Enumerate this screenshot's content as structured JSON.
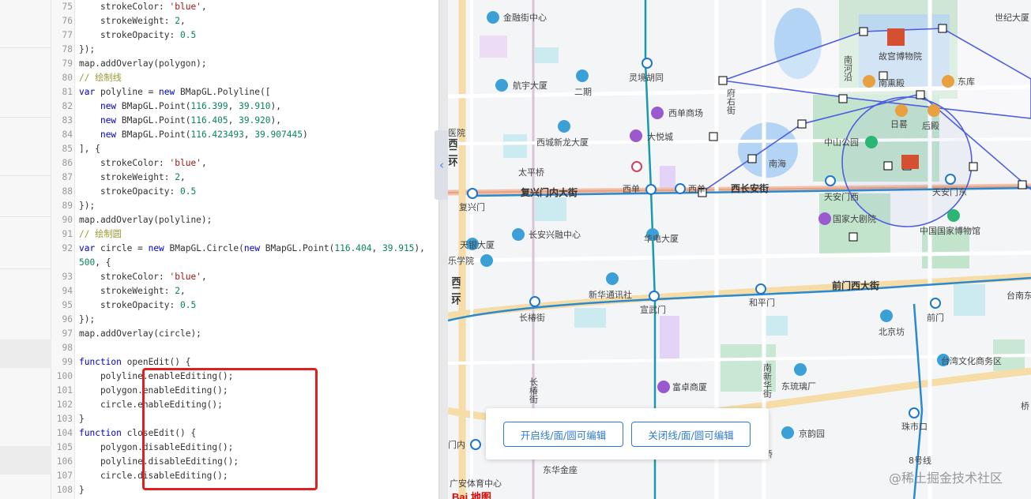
{
  "editor": {
    "lines": [
      {
        "n": "75",
        "segs": [
          [
            "",
            "    strokeColor: "
          ],
          [
            "str",
            "'blue'"
          ],
          [
            "",
            ","
          ]
        ]
      },
      {
        "n": "76",
        "segs": [
          [
            "",
            "    strokeWeight: "
          ],
          [
            "num",
            "2"
          ],
          [
            "",
            ","
          ]
        ]
      },
      {
        "n": "77",
        "segs": [
          [
            "",
            "    strokeOpacity: "
          ],
          [
            "num",
            "0.5"
          ]
        ]
      },
      {
        "n": "78",
        "segs": [
          [
            "",
            "});"
          ]
        ]
      },
      {
        "n": "79",
        "segs": [
          [
            "",
            "map.addOverlay(polygon);"
          ]
        ]
      },
      {
        "n": "80",
        "segs": [
          [
            "cm",
            "// 绘制线"
          ]
        ]
      },
      {
        "n": "81",
        "segs": [
          [
            "kw",
            "var"
          ],
          [
            "",
            " polyline = "
          ],
          [
            "kw",
            "new"
          ],
          [
            "",
            " BMapGL.Polyline(["
          ]
        ]
      },
      {
        "n": "82",
        "segs": [
          [
            "",
            "    "
          ],
          [
            "kw",
            "new"
          ],
          [
            "",
            " BMapGL.Point("
          ],
          [
            "num",
            "116.399"
          ],
          [
            "",
            ", "
          ],
          [
            "num",
            "39.910"
          ],
          [
            "",
            "),"
          ]
        ]
      },
      {
        "n": "83",
        "segs": [
          [
            "",
            "    "
          ],
          [
            "kw",
            "new"
          ],
          [
            "",
            " BMapGL.Point("
          ],
          [
            "num",
            "116.405"
          ],
          [
            "",
            ", "
          ],
          [
            "num",
            "39.920"
          ],
          [
            "",
            "),"
          ]
        ]
      },
      {
        "n": "84",
        "segs": [
          [
            "",
            "    "
          ],
          [
            "kw",
            "new"
          ],
          [
            "",
            " BMapGL.Point("
          ],
          [
            "num",
            "116.423493"
          ],
          [
            "",
            ", "
          ],
          [
            "num",
            "39.907445"
          ],
          [
            "",
            ")"
          ]
        ]
      },
      {
        "n": "85",
        "segs": [
          [
            "",
            "], {"
          ]
        ]
      },
      {
        "n": "86",
        "segs": [
          [
            "",
            "    strokeColor: "
          ],
          [
            "str",
            "'blue'"
          ],
          [
            "",
            ","
          ]
        ]
      },
      {
        "n": "87",
        "segs": [
          [
            "",
            "    strokeWeight: "
          ],
          [
            "num",
            "2"
          ],
          [
            "",
            ","
          ]
        ]
      },
      {
        "n": "88",
        "segs": [
          [
            "",
            "    strokeOpacity: "
          ],
          [
            "num",
            "0.5"
          ]
        ]
      },
      {
        "n": "89",
        "segs": [
          [
            "",
            "});"
          ]
        ]
      },
      {
        "n": "90",
        "segs": [
          [
            "",
            "map.addOverlay(polyline);"
          ]
        ]
      },
      {
        "n": "91",
        "segs": [
          [
            "cm",
            "// 绘制圆"
          ]
        ]
      },
      {
        "n": "92",
        "segs": [
          [
            "kw",
            "var"
          ],
          [
            "",
            " circle = "
          ],
          [
            "kw",
            "new"
          ],
          [
            "",
            " BMapGL.Circle("
          ],
          [
            "kw",
            "new"
          ],
          [
            "",
            " BMapGL.Point("
          ],
          [
            "num",
            "116.404"
          ],
          [
            "",
            ", "
          ],
          [
            "num",
            "39.915"
          ],
          [
            "",
            "),"
          ]
        ]
      },
      {
        "n": "",
        "segs": [
          [
            "num",
            "500"
          ],
          [
            "",
            ", {"
          ]
        ]
      },
      {
        "n": "93",
        "segs": [
          [
            "",
            "    strokeColor: "
          ],
          [
            "str",
            "'blue'"
          ],
          [
            "",
            ","
          ]
        ]
      },
      {
        "n": "94",
        "segs": [
          [
            "",
            "    strokeWeight: "
          ],
          [
            "num",
            "2"
          ],
          [
            "",
            ","
          ]
        ]
      },
      {
        "n": "95",
        "segs": [
          [
            "",
            "    strokeOpacity: "
          ],
          [
            "num",
            "0.5"
          ]
        ]
      },
      {
        "n": "96",
        "segs": [
          [
            "",
            "});"
          ]
        ]
      },
      {
        "n": "97",
        "segs": [
          [
            "",
            "map.addOverlay(circle);"
          ]
        ]
      },
      {
        "n": "98",
        "segs": []
      },
      {
        "n": "99",
        "segs": [
          [
            "kw",
            "function"
          ],
          [
            "",
            " openEdit() {"
          ]
        ]
      },
      {
        "n": "100",
        "segs": [
          [
            "",
            "    polyline.enableEditing();"
          ]
        ]
      },
      {
        "n": "101",
        "segs": [
          [
            "",
            "    polygon.enableEditing();"
          ]
        ]
      },
      {
        "n": "102",
        "segs": [
          [
            "",
            "    circle.enableEditing();"
          ]
        ]
      },
      {
        "n": "103",
        "segs": [
          [
            "",
            "}"
          ]
        ]
      },
      {
        "n": "104",
        "segs": [
          [
            "kw",
            "function"
          ],
          [
            "",
            " closeEdit() {"
          ]
        ]
      },
      {
        "n": "105",
        "segs": [
          [
            "",
            "    polygon.disableEditing();"
          ]
        ]
      },
      {
        "n": "106",
        "segs": [
          [
            "",
            "    polyline.disableEditing();"
          ]
        ]
      },
      {
        "n": "107",
        "segs": [
          [
            "",
            "    circle.disableEditing();"
          ]
        ]
      },
      {
        "n": "108",
        "segs": [
          [
            "",
            "}"
          ]
        ]
      }
    ]
  },
  "collapse_icon": "chevron-left-icon",
  "map": {
    "roads": {
      "fuxingmen": "复兴门内大街",
      "xichangan": "西长安街",
      "qianmen_west": "前门西大街",
      "west_2nd_ring": "西二环",
      "west_2nd_ring_2": "西二环",
      "fuyoujie": "府右街",
      "nanheyan": "南河沿",
      "changchunjie": "长椿街",
      "nanxinhuajie": "南新华街"
    },
    "pois": [
      "金融街中心",
      "灵境胡同",
      "航宇大厦",
      "二期",
      "西单商场",
      "西城新龙大厦",
      "大悦城",
      "太平桥",
      "西单",
      "西单",
      "复兴门",
      "长安兴融中心",
      "华电大厦",
      "天银大厦",
      "乐学院",
      "新华通讯社",
      "宣武门",
      "和平门",
      "长椿街",
      "前门",
      "北京坊",
      "台湾文化商务区",
      "东琉璃厂",
      "富卓商厦",
      "京韵园",
      "珠市口",
      "东华金座",
      "门内",
      "广安体育中心",
      "故宫博物院",
      "南熏殿",
      "东库",
      "日晷",
      "后殿",
      "中山公园",
      "南海",
      "天安门西",
      "天安门东",
      "国家大剧院",
      "中国国家博物馆",
      "世纪大厦",
      "医院",
      "台南东",
      "桥",
      "8号线",
      "桥"
    ],
    "colors": {
      "overlay_stroke": "#4d5fe0",
      "road_red": "#e3a090",
      "metro_blue": "#2a8ad0",
      "metro_teal": "#1a9aa8",
      "park_green": "#b5e1c5",
      "water_blue": "#b3d4f5"
    }
  },
  "buttons": {
    "open_edit": "开启线/面/圆可编辑",
    "close_edit": "关闭线/面/圆可编辑"
  },
  "watermark": "@稀土掘金技术社区",
  "baidu_logo": "Bai 地图"
}
